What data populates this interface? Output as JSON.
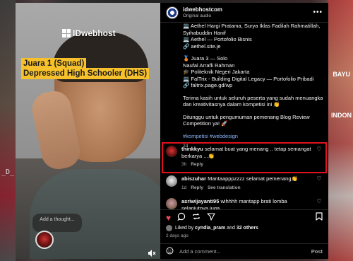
{
  "background": {
    "left_text": "_D_",
    "right_text_1": "BAYU",
    "right_text_2": "INDON"
  },
  "video": {
    "brand": "IDwebhost",
    "tag_line_1": "Juara 1 (Squad)",
    "tag_line_2": "Depressed High Schooler (DHS)",
    "note_placeholder": "Add a thought...",
    "icons": {
      "mute": "speaker-off-icon"
    }
  },
  "post": {
    "username": "idwebhostcom",
    "subtitle": "Original audio",
    "caption_lines": [
      "💻 Aethel Hargi Pratama, Surya Iklas Fadilah Rahmatillah,",
      "Syihabuddin Hanif",
      "💻 Aethel — Portofolio Bisnis",
      "🔗 aethel.site.je",
      "",
      "🥉 Juara 3 — Solo",
      "Naufal Arrafli Rahman",
      "🎓 Politeknik Negeri Jakarta",
      "💻 FalTrix - Building Digital Legacy — Portofolio Pribadi",
      "🔗 faltrix.page.gd/wp",
      "",
      "Terima kasih untuk seluruh peserta yang sudah menuangkan ide",
      "dan kreativitasnya dalam kompetisi ini 👏",
      "",
      "Ditunggu untuk pengumuman pemenang Blog Review",
      "Competition ya! 🚀"
    ],
    "hashtags": "#kompetisi #webdesign",
    "caption_time": "2d"
  },
  "comments": [
    {
      "user": "thinkkyu",
      "text": "selamat buat yang menang .. tetap semangat berkarya ...👏",
      "time": "3h",
      "likes": "",
      "reply": "Reply",
      "see_translation": ""
    },
    {
      "user": "abiszuhar",
      "text": "Mantaapppzzzz selamat pemenang👏",
      "time": "1d",
      "likes": "",
      "reply": "Reply",
      "see_translation": "See translation"
    },
    {
      "user": "asriwijayanti95",
      "text": "wihhhh mantapp brati lomba selanjutnya juga",
      "time": "",
      "likes": "",
      "reply": "",
      "see_translation": ""
    }
  ],
  "actions": {
    "liked_by_prefix": "Liked by",
    "liked_by_user": "cyndia_pram",
    "liked_by_and": "and",
    "liked_by_others": "32 others",
    "posted": "2 days ago",
    "comment_placeholder": "Add a comment...",
    "post_label": "Post"
  },
  "colors": {
    "highlight": "#e0111d",
    "like": "#ed4956",
    "tag_yellow": "#f7c12b",
    "hashtag": "#8ab4f8"
  }
}
